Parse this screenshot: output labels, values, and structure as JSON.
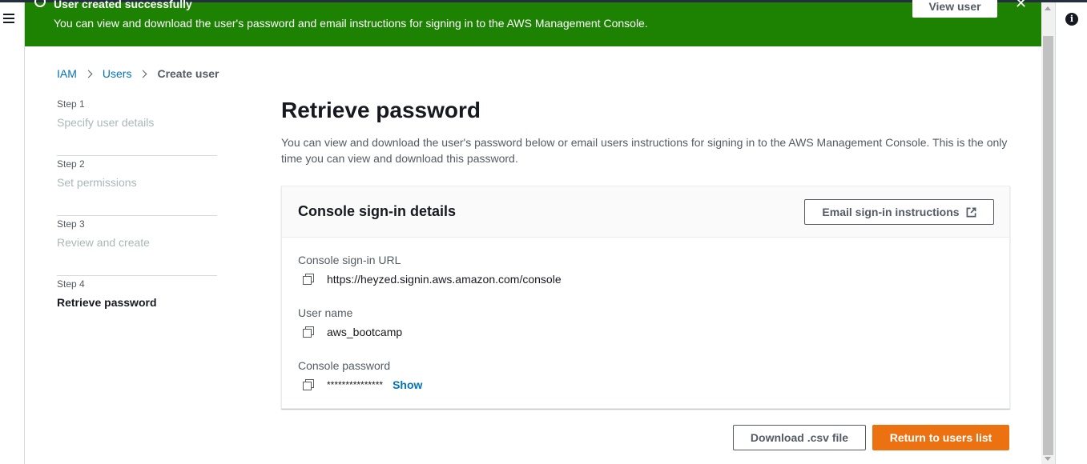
{
  "flash": {
    "title": "User created successfully",
    "message": "You can view and download the user's password and email instructions for signing in to the AWS Management Console.",
    "view_user_label": "View user",
    "close_glyph": "✕",
    "color": "#1d8102"
  },
  "breadcrumb": {
    "items": [
      "IAM",
      "Users",
      "Create user"
    ]
  },
  "steps": [
    {
      "num": "Step 1",
      "name": "Specify user details"
    },
    {
      "num": "Step 2",
      "name": "Set permissions"
    },
    {
      "num": "Step 3",
      "name": "Review and create"
    },
    {
      "num": "Step 4",
      "name": "Retrieve password"
    }
  ],
  "main": {
    "title": "Retrieve password",
    "description": "You can view and download the user's password below or email users instructions for signing in to the AWS Management Console. This is the only time you can view and download this password."
  },
  "card": {
    "title": "Console sign-in details",
    "email_button_label": "Email sign-in instructions",
    "fields": [
      {
        "label": "Console sign-in URL",
        "value": "https://heyzed.signin.aws.amazon.com/console"
      },
      {
        "label": "User name",
        "value": "aws_bootcamp"
      },
      {
        "label": "Console password",
        "value": "***************",
        "show_label": "Show"
      }
    ]
  },
  "actions": {
    "download_label": "Download .csv file",
    "return_label": "Return to users list",
    "primary_color": "#ec7211"
  },
  "icons": {
    "menu": "hamburger-icon",
    "info": "info-icon",
    "external": "external-link-icon",
    "copy": "copy-icon",
    "success": "check-circle-icon"
  }
}
